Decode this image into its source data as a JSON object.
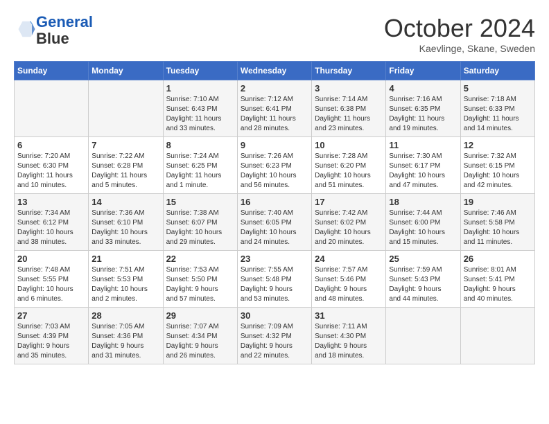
{
  "header": {
    "logo_line1": "General",
    "logo_line2": "Blue",
    "title": "October 2024",
    "location": "Kaevlinge, Skane, Sweden"
  },
  "days_of_week": [
    "Sunday",
    "Monday",
    "Tuesday",
    "Wednesday",
    "Thursday",
    "Friday",
    "Saturday"
  ],
  "weeks": [
    [
      {
        "day": "",
        "content": ""
      },
      {
        "day": "",
        "content": ""
      },
      {
        "day": "1",
        "content": "Sunrise: 7:10 AM\nSunset: 6:43 PM\nDaylight: 11 hours\nand 33 minutes."
      },
      {
        "day": "2",
        "content": "Sunrise: 7:12 AM\nSunset: 6:41 PM\nDaylight: 11 hours\nand 28 minutes."
      },
      {
        "day": "3",
        "content": "Sunrise: 7:14 AM\nSunset: 6:38 PM\nDaylight: 11 hours\nand 23 minutes."
      },
      {
        "day": "4",
        "content": "Sunrise: 7:16 AM\nSunset: 6:35 PM\nDaylight: 11 hours\nand 19 minutes."
      },
      {
        "day": "5",
        "content": "Sunrise: 7:18 AM\nSunset: 6:33 PM\nDaylight: 11 hours\nand 14 minutes."
      }
    ],
    [
      {
        "day": "6",
        "content": "Sunrise: 7:20 AM\nSunset: 6:30 PM\nDaylight: 11 hours\nand 10 minutes."
      },
      {
        "day": "7",
        "content": "Sunrise: 7:22 AM\nSunset: 6:28 PM\nDaylight: 11 hours\nand 5 minutes."
      },
      {
        "day": "8",
        "content": "Sunrise: 7:24 AM\nSunset: 6:25 PM\nDaylight: 11 hours\nand 1 minute."
      },
      {
        "day": "9",
        "content": "Sunrise: 7:26 AM\nSunset: 6:23 PM\nDaylight: 10 hours\nand 56 minutes."
      },
      {
        "day": "10",
        "content": "Sunrise: 7:28 AM\nSunset: 6:20 PM\nDaylight: 10 hours\nand 51 minutes."
      },
      {
        "day": "11",
        "content": "Sunrise: 7:30 AM\nSunset: 6:17 PM\nDaylight: 10 hours\nand 47 minutes."
      },
      {
        "day": "12",
        "content": "Sunrise: 7:32 AM\nSunset: 6:15 PM\nDaylight: 10 hours\nand 42 minutes."
      }
    ],
    [
      {
        "day": "13",
        "content": "Sunrise: 7:34 AM\nSunset: 6:12 PM\nDaylight: 10 hours\nand 38 minutes."
      },
      {
        "day": "14",
        "content": "Sunrise: 7:36 AM\nSunset: 6:10 PM\nDaylight: 10 hours\nand 33 minutes."
      },
      {
        "day": "15",
        "content": "Sunrise: 7:38 AM\nSunset: 6:07 PM\nDaylight: 10 hours\nand 29 minutes."
      },
      {
        "day": "16",
        "content": "Sunrise: 7:40 AM\nSunset: 6:05 PM\nDaylight: 10 hours\nand 24 minutes."
      },
      {
        "day": "17",
        "content": "Sunrise: 7:42 AM\nSunset: 6:02 PM\nDaylight: 10 hours\nand 20 minutes."
      },
      {
        "day": "18",
        "content": "Sunrise: 7:44 AM\nSunset: 6:00 PM\nDaylight: 10 hours\nand 15 minutes."
      },
      {
        "day": "19",
        "content": "Sunrise: 7:46 AM\nSunset: 5:58 PM\nDaylight: 10 hours\nand 11 minutes."
      }
    ],
    [
      {
        "day": "20",
        "content": "Sunrise: 7:48 AM\nSunset: 5:55 PM\nDaylight: 10 hours\nand 6 minutes."
      },
      {
        "day": "21",
        "content": "Sunrise: 7:51 AM\nSunset: 5:53 PM\nDaylight: 10 hours\nand 2 minutes."
      },
      {
        "day": "22",
        "content": "Sunrise: 7:53 AM\nSunset: 5:50 PM\nDaylight: 9 hours\nand 57 minutes."
      },
      {
        "day": "23",
        "content": "Sunrise: 7:55 AM\nSunset: 5:48 PM\nDaylight: 9 hours\nand 53 minutes."
      },
      {
        "day": "24",
        "content": "Sunrise: 7:57 AM\nSunset: 5:46 PM\nDaylight: 9 hours\nand 48 minutes."
      },
      {
        "day": "25",
        "content": "Sunrise: 7:59 AM\nSunset: 5:43 PM\nDaylight: 9 hours\nand 44 minutes."
      },
      {
        "day": "26",
        "content": "Sunrise: 8:01 AM\nSunset: 5:41 PM\nDaylight: 9 hours\nand 40 minutes."
      }
    ],
    [
      {
        "day": "27",
        "content": "Sunrise: 7:03 AM\nSunset: 4:39 PM\nDaylight: 9 hours\nand 35 minutes."
      },
      {
        "day": "28",
        "content": "Sunrise: 7:05 AM\nSunset: 4:36 PM\nDaylight: 9 hours\nand 31 minutes."
      },
      {
        "day": "29",
        "content": "Sunrise: 7:07 AM\nSunset: 4:34 PM\nDaylight: 9 hours\nand 26 minutes."
      },
      {
        "day": "30",
        "content": "Sunrise: 7:09 AM\nSunset: 4:32 PM\nDaylight: 9 hours\nand 22 minutes."
      },
      {
        "day": "31",
        "content": "Sunrise: 7:11 AM\nSunset: 4:30 PM\nDaylight: 9 hours\nand 18 minutes."
      },
      {
        "day": "",
        "content": ""
      },
      {
        "day": "",
        "content": ""
      }
    ]
  ]
}
